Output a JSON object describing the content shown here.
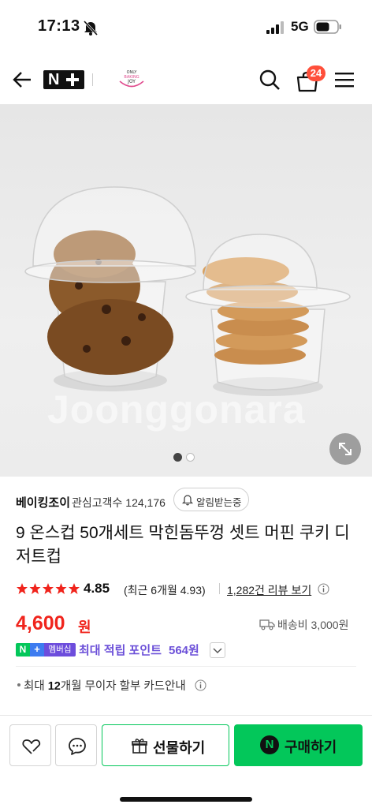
{
  "status_bar": {
    "time": "17:13",
    "network": "5G"
  },
  "header": {
    "brand_logo": "N+",
    "store_logo_text": "ONLY BAKING JOY",
    "cart_count": "24"
  },
  "gallery": {
    "watermark": "Joonggonara",
    "current_page": 1,
    "total_pages": 2
  },
  "seller": {
    "name": "베이킹조이",
    "fans": "관심고객수 124,176",
    "notify_label": "알림받는중"
  },
  "product": {
    "title": "9 온스컵 50개세트 막힌돔뚜껑 셋트 머핀 쿠키 디저트컵",
    "rating": "4.85",
    "rating_stars": 5,
    "recent_rating": "(최근 6개월 4.93)",
    "review_link": "1,282건 리뷰 보기",
    "price": "4,600",
    "price_unit": "원",
    "shipping": "배송비 3,000원"
  },
  "points": {
    "badge_membership": "멤버십",
    "label": "최대 적립 포인트",
    "value": "564원"
  },
  "installment": {
    "prefix": "최대 ",
    "months": "12",
    "suffix": "개월 무이자 할부 카드안내"
  },
  "bottom_bar": {
    "gift_label": "선물하기",
    "buy_label": "구매하기",
    "buy_icon": "N"
  },
  "colors": {
    "naver_green": "#03c75a",
    "price_red": "#f0241c",
    "points_purple": "#6b4fd8",
    "badge_red": "#ff4f3a"
  }
}
